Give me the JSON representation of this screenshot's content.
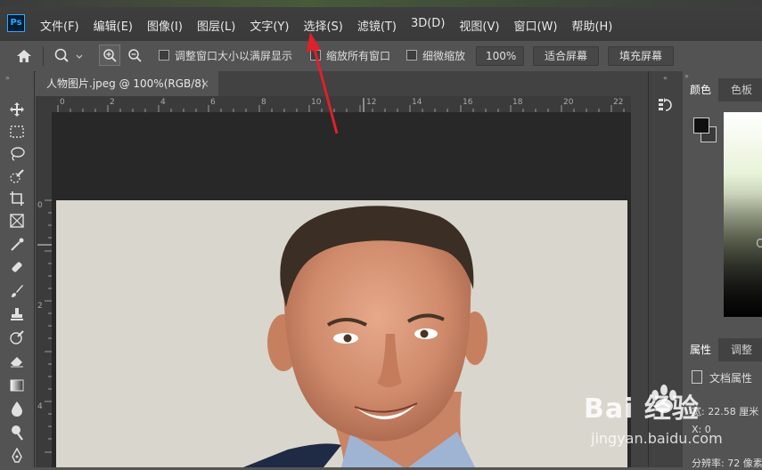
{
  "app": {
    "logo": "Ps"
  },
  "menu": {
    "items": [
      "文件(F)",
      "编辑(E)",
      "图像(I)",
      "图层(L)",
      "文字(Y)",
      "选择(S)",
      "滤镜(T)",
      "3D(D)",
      "视图(V)",
      "窗口(W)",
      "帮助(H)"
    ]
  },
  "options": {
    "resize_windows": "调整窗口大小以满屏显示",
    "zoom_all": "缩放所有窗口",
    "scrubby_zoom": "细微缩放",
    "zoom_value": "100%",
    "fit_screen": "适合屏幕",
    "fill_screen": "填充屏幕"
  },
  "document": {
    "tab_title": "人物图片.jpeg @ 100%(RGB/8)",
    "close": "×"
  },
  "ruler": {
    "h_ticks": [
      "0",
      "2",
      "4",
      "6",
      "8",
      "10",
      "12",
      "14",
      "16",
      "18",
      "20",
      "22"
    ],
    "v_ticks": [
      "0",
      "2",
      "4"
    ]
  },
  "panels": {
    "color_tab": "颜色",
    "swatches_tab": "色板",
    "properties_tab": "属性",
    "adjust_tab": "调整",
    "doc_props": "文档属性",
    "width_line": "宽: 22.58 厘米",
    "x_line": "X: 0",
    "resolution_line": "分辨率: 72 像素"
  },
  "watermark": {
    "brand": "Bai  经验",
    "url": "jingyan.baidu.com"
  },
  "colors": {
    "accent": "#31a8ff",
    "arrow": "#e0202a"
  },
  "icons": {
    "home": "home-icon",
    "zoom": "zoom-tool-icon",
    "zoom_in": "zoom-in-icon",
    "zoom_out": "zoom-out-icon"
  }
}
